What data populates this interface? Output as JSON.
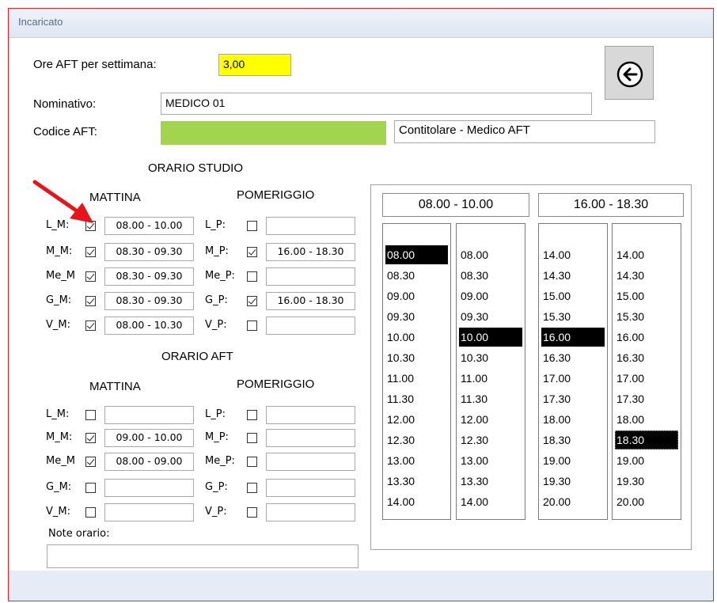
{
  "window": {
    "title": "Incaricato"
  },
  "header": {
    "ore_label": "Ore AFT per settimana:",
    "ore_value": "3,00",
    "nominativo_label": "Nominativo:",
    "nominativo_value": "MEDICO 01",
    "codice_label": "Codice AFT:",
    "codice_value": "",
    "ruolo_value": "Contitolare - Medico AFT"
  },
  "back_button": {
    "icon": "back-arrow-icon"
  },
  "orario_studio": {
    "title": "ORARIO STUDIO",
    "mattina_label": "MATTINA",
    "pomeriggio_label": "POMERIGGIO",
    "rows": [
      {
        "m_label": "L_M:",
        "m_checked": true,
        "m_value": "08.00 - 10.00",
        "p_label": "L_P:",
        "p_checked": false,
        "p_value": ""
      },
      {
        "m_label": "M_M:",
        "m_checked": true,
        "m_value": "08.30 - 09.30",
        "p_label": "M_P:",
        "p_checked": true,
        "p_value": "16.00 - 18.30"
      },
      {
        "m_label": "Me_M",
        "m_checked": true,
        "m_value": "08.30 - 09.30",
        "p_label": "Me_P:",
        "p_checked": false,
        "p_value": ""
      },
      {
        "m_label": "G_M:",
        "m_checked": true,
        "m_value": "08.30 - 09.30",
        "p_label": "G_P:",
        "p_checked": true,
        "p_value": "16.00 - 18.30"
      },
      {
        "m_label": "V_M:",
        "m_checked": true,
        "m_value": "08.00 - 10.30",
        "p_label": "V_P:",
        "p_checked": false,
        "p_value": ""
      }
    ]
  },
  "orario_aft": {
    "title": "ORARIO AFT",
    "mattina_label": "MATTINA",
    "pomeriggio_label": "POMERIGGIO",
    "rows": [
      {
        "m_label": "L_M:",
        "m_checked": false,
        "m_value": "",
        "p_label": "L_P:",
        "p_checked": false,
        "p_value": ""
      },
      {
        "m_label": "M_M:",
        "m_checked": true,
        "m_value": "09.00 - 10.00",
        "p_label": "M_P:",
        "p_checked": false,
        "p_value": ""
      },
      {
        "m_label": "Me_M",
        "m_checked": true,
        "m_value": "08.00 - 09.00",
        "p_label": "Me_P:",
        "p_checked": false,
        "p_value": ""
      },
      {
        "m_label": "G_M:",
        "m_checked": false,
        "m_value": "",
        "p_label": "G_P:",
        "p_checked": false,
        "p_value": ""
      },
      {
        "m_label": "V_M:",
        "m_checked": false,
        "m_value": "",
        "p_label": "V_P:",
        "p_checked": false,
        "p_value": ""
      }
    ]
  },
  "note": {
    "label": "Note orario:",
    "value": ""
  },
  "time_picker": {
    "mattina_range": "08.00 - 10.00",
    "pomeriggio_range": "16.00 - 18.30",
    "lists": [
      {
        "items": [
          "08.00",
          "08.30",
          "09.00",
          "09.30",
          "10.00",
          "10.30",
          "11.00",
          "11.30",
          "12.00",
          "12.30",
          "13.00",
          "13.30",
          "14.00"
        ],
        "selected": "08.00"
      },
      {
        "items": [
          "08.00",
          "08.30",
          "09.00",
          "09.30",
          "10.00",
          "10.30",
          "11.00",
          "11.30",
          "12.00",
          "12.30",
          "13.00",
          "13.30",
          "14.00"
        ],
        "selected": "10.00"
      },
      {
        "items": [
          "14.00",
          "14.30",
          "15.00",
          "15.30",
          "16.00",
          "16.30",
          "17.00",
          "17.30",
          "18.00",
          "18.30",
          "19.00",
          "19.30",
          "20.00"
        ],
        "selected": "16.00"
      },
      {
        "items": [
          "14.00",
          "14.30",
          "15.00",
          "15.30",
          "16.00",
          "16.30",
          "17.00",
          "17.30",
          "18.00",
          "18.30",
          "19.00",
          "19.30",
          "20.00"
        ],
        "selected": "18.30"
      }
    ]
  },
  "colors": {
    "ore_bg": "#ffff00",
    "codice_bg": "#a3d44f",
    "arrow": "#e8141c",
    "window_border": "#e8202a"
  }
}
